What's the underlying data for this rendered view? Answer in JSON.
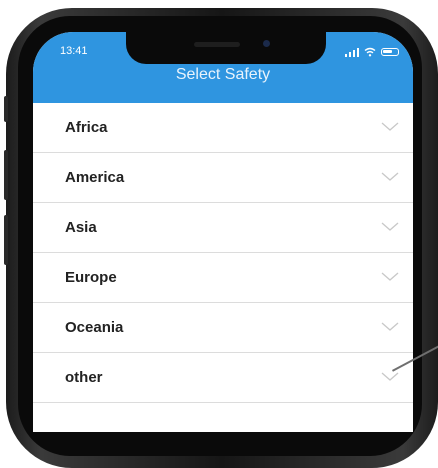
{
  "status_bar": {
    "time": "13:41"
  },
  "header": {
    "title": "Select Safety"
  },
  "regions": [
    {
      "label": "Africa"
    },
    {
      "label": "America"
    },
    {
      "label": "Asia"
    },
    {
      "label": "Europe"
    },
    {
      "label": "Oceania"
    },
    {
      "label": "other"
    }
  ],
  "colors": {
    "header_bg": "#2f95e0",
    "divider": "#dcdcdc",
    "chevron": "#c8c8c8"
  },
  "icons": {
    "row_icon": "chevron-down-icon"
  }
}
